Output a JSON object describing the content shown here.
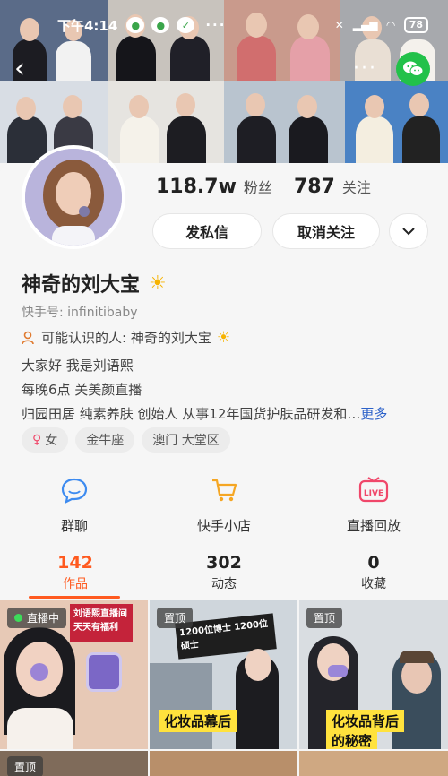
{
  "status_bar": {
    "time": "下午4:14",
    "battery": "78"
  },
  "profile": {
    "followers_count": "118.7w",
    "followers_label": "粉丝",
    "following_count": "787",
    "following_label": "关注",
    "name": "神奇的刘大宝",
    "kuaishou_id": "快手号: infinitibaby",
    "may_know": "可能认识的人: 神奇的刘大宝",
    "bio": [
      "大家好 我是刘语熙",
      "每晚6点 关美颜直播"
    ],
    "description": "归园田居  纯素养肤  创始人  从事12年国货护肤品研发和…",
    "more_link": "更多",
    "tags": [
      "女",
      "金牛座",
      "澳门 大堂区"
    ]
  },
  "actions": {
    "message": "发私信",
    "unfollow": "取消关注"
  },
  "features": [
    {
      "label": "群聊",
      "icon": "chat-bubble-icon"
    },
    {
      "label": "快手小店",
      "icon": "shopping-cart-icon"
    },
    {
      "label": "直播回放",
      "icon": "live-replay-icon"
    }
  ],
  "live_icon_text": "LIVE",
  "tabs": [
    {
      "count": "142",
      "label": "作品"
    },
    {
      "count": "302",
      "label": "动态"
    },
    {
      "count": "0",
      "label": "收藏"
    }
  ],
  "grid": {
    "live_badge": "直播中",
    "pinned_badge": "置顶",
    "cell1_sign": "刘语熙直播间 天天有福利",
    "cell2_text": "化妆品幕后",
    "cell2_top": "1200位博士 1200位硕士",
    "cell3_text1": "化妆品背后",
    "cell3_text2": "的秘密"
  },
  "colors": {
    "accent": "#ff5a1f",
    "link": "#2d62c9",
    "wechat": "#22c14a"
  }
}
